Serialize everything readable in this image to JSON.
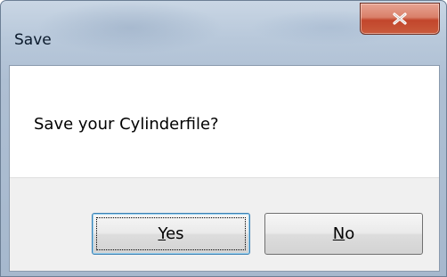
{
  "window": {
    "title": "Save",
    "close_icon": "close-x-icon"
  },
  "dialog": {
    "message": "Save your Cylinderfile?"
  },
  "buttons": {
    "yes": {
      "mnemonic": "Y",
      "rest": "es"
    },
    "no": {
      "mnemonic": "N",
      "rest": "o"
    }
  },
  "colors": {
    "close_button": "#c95a3c",
    "focus_border": "#3c7fb1",
    "footer_bg": "#f0f0f0"
  }
}
